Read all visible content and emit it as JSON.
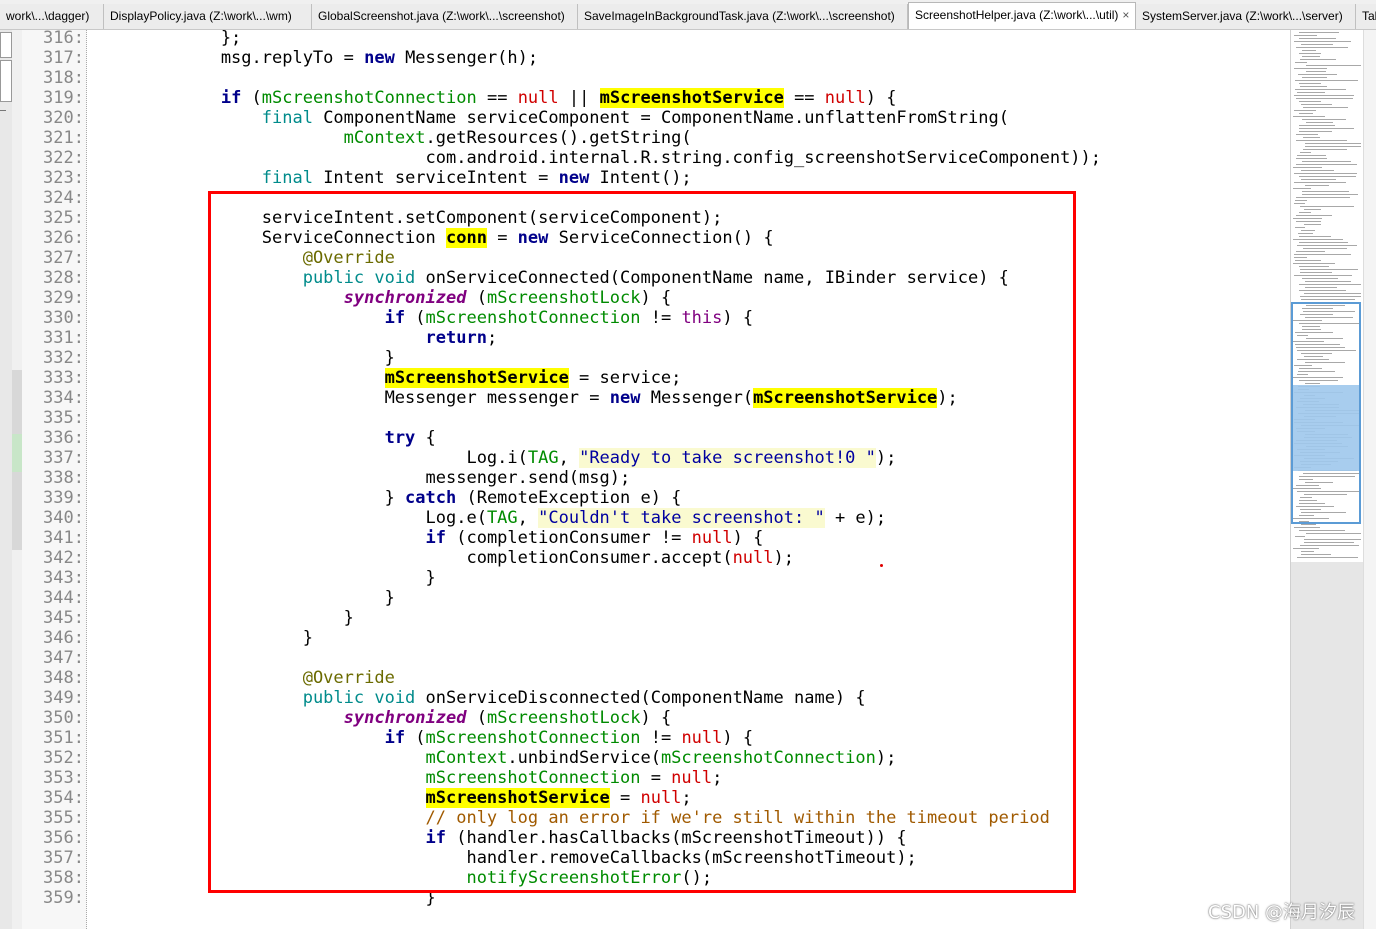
{
  "tabs": [
    {
      "label": "work\\...\\dagger)",
      "active": false
    },
    {
      "label": "DisplayPolicy.java (Z:\\work\\...\\wm)",
      "active": false
    },
    {
      "label": "GlobalScreenshot.java (Z:\\work\\...\\screenshot)",
      "active": false
    },
    {
      "label": "SaveImageInBackgroundTask.java (Z:\\work\\...\\screenshot)",
      "active": false
    },
    {
      "label": "ScreenshotHelper.java (Z:\\work\\...\\util)",
      "active": true
    },
    {
      "label": "SystemServer.java (Z:\\work\\...\\server)",
      "active": false
    },
    {
      "label": "Tak",
      "active": false
    }
  ],
  "close_glyph": "×",
  "watermark": "CSDN @海月汐辰",
  "lines": [
    {
      "n": "316:",
      "s": [
        [
          "p",
          "            };"
        ]
      ]
    },
    {
      "n": "317:",
      "s": [
        [
          "p",
          "            msg.replyTo = "
        ],
        [
          "kw",
          "new"
        ],
        [
          "p",
          " Messenger(h);"
        ]
      ]
    },
    {
      "n": "318:",
      "s": []
    },
    {
      "n": "319:",
      "s": [
        [
          "p",
          "            "
        ],
        [
          "kw",
          "if"
        ],
        [
          "p",
          " ("
        ],
        [
          "field",
          "mScreenshotConnection"
        ],
        [
          "p",
          " == "
        ],
        [
          "nul",
          "null"
        ],
        [
          "p",
          " || "
        ],
        [
          "hl",
          "mScreenshotService"
        ],
        [
          "p",
          " == "
        ],
        [
          "nul",
          "null"
        ],
        [
          "p",
          ") {"
        ]
      ]
    },
    {
      "n": "320:",
      "s": [
        [
          "p",
          "                "
        ],
        [
          "mod",
          "final"
        ],
        [
          "p",
          " ComponentName serviceComponent = ComponentName.unflattenFromString("
        ]
      ]
    },
    {
      "n": "321:",
      "s": [
        [
          "p",
          "                        "
        ],
        [
          "field",
          "mContext"
        ],
        [
          "p",
          ".getResources().getString("
        ]
      ]
    },
    {
      "n": "322:",
      "s": [
        [
          "p",
          "                                com.android.internal.R.string.config_screenshotServiceComponent));"
        ]
      ]
    },
    {
      "n": "323:",
      "s": [
        [
          "p",
          "                "
        ],
        [
          "mod",
          "final"
        ],
        [
          "p",
          " Intent serviceIntent = "
        ],
        [
          "kw",
          "new"
        ],
        [
          "p",
          " Intent();"
        ]
      ]
    },
    {
      "n": "324:",
      "s": []
    },
    {
      "n": "325:",
      "s": [
        [
          "p",
          "                serviceIntent.setComponent(serviceComponent);"
        ]
      ]
    },
    {
      "n": "326:",
      "s": [
        [
          "p",
          "                ServiceConnection "
        ],
        [
          "hl",
          "conn"
        ],
        [
          "p",
          " = "
        ],
        [
          "kw",
          "new"
        ],
        [
          "p",
          " ServiceConnection() {"
        ]
      ]
    },
    {
      "n": "327:",
      "s": [
        [
          "p",
          "                    "
        ],
        [
          "ann",
          "@Override"
        ]
      ]
    },
    {
      "n": "328:",
      "s": [
        [
          "p",
          "                    "
        ],
        [
          "mod",
          "public void"
        ],
        [
          "p",
          " onServiceConnected(ComponentName name, IBinder service) {"
        ]
      ]
    },
    {
      "n": "329:",
      "s": [
        [
          "p",
          "                        "
        ],
        [
          "syn",
          "synchronized"
        ],
        [
          "p",
          " ("
        ],
        [
          "field",
          "mScreenshotLock"
        ],
        [
          "p",
          ") {"
        ]
      ]
    },
    {
      "n": "330:",
      "s": [
        [
          "p",
          "                            "
        ],
        [
          "kw",
          "if"
        ],
        [
          "p",
          " ("
        ],
        [
          "field",
          "mScreenshotConnection"
        ],
        [
          "p",
          " != "
        ],
        [
          "pu",
          "this"
        ],
        [
          "p",
          ") {"
        ]
      ]
    },
    {
      "n": "331:",
      "s": [
        [
          "p",
          "                                "
        ],
        [
          "kw",
          "return"
        ],
        [
          "p",
          ";"
        ]
      ]
    },
    {
      "n": "332:",
      "s": [
        [
          "p",
          "                            }"
        ]
      ]
    },
    {
      "n": "333:",
      "s": [
        [
          "p",
          "                            "
        ],
        [
          "hl",
          "mScreenshotService"
        ],
        [
          "p",
          " = service;"
        ]
      ]
    },
    {
      "n": "334:",
      "s": [
        [
          "p",
          "                            Messenger messenger = "
        ],
        [
          "kw",
          "new"
        ],
        [
          "p",
          " Messenger("
        ],
        [
          "hl",
          "mScreenshotService"
        ],
        [
          "p",
          ");"
        ]
      ]
    },
    {
      "n": "335:",
      "s": []
    },
    {
      "n": "336:",
      "s": [
        [
          "p",
          "                            "
        ],
        [
          "kw",
          "try"
        ],
        [
          "p",
          " {"
        ]
      ]
    },
    {
      "n": "337:",
      "s": [
        [
          "p",
          "                                    Log.i("
        ],
        [
          "field",
          "TAG"
        ],
        [
          "p",
          ", "
        ],
        [
          "str",
          "\"Ready to take screenshot!0 \""
        ],
        [
          "p",
          ");"
        ]
      ]
    },
    {
      "n": "338:",
      "s": [
        [
          "p",
          "                                messenger.send(msg);"
        ]
      ]
    },
    {
      "n": "339:",
      "s": [
        [
          "p",
          "                            } "
        ],
        [
          "kw",
          "catch"
        ],
        [
          "p",
          " (RemoteException e) {"
        ]
      ]
    },
    {
      "n": "340:",
      "s": [
        [
          "p",
          "                                Log.e("
        ],
        [
          "field",
          "TAG"
        ],
        [
          "p",
          ", "
        ],
        [
          "str",
          "\"Couldn't take screenshot: \""
        ],
        [
          "p",
          " + e);"
        ]
      ]
    },
    {
      "n": "341:",
      "s": [
        [
          "p",
          "                                "
        ],
        [
          "kw",
          "if"
        ],
        [
          "p",
          " (completionConsumer != "
        ],
        [
          "nul",
          "null"
        ],
        [
          "p",
          ") {"
        ]
      ]
    },
    {
      "n": "342:",
      "s": [
        [
          "p",
          "                                    completionConsumer.accept("
        ],
        [
          "nul",
          "null"
        ],
        [
          "p",
          ");"
        ]
      ]
    },
    {
      "n": "343:",
      "s": [
        [
          "p",
          "                                }"
        ]
      ]
    },
    {
      "n": "344:",
      "s": [
        [
          "p",
          "                            }"
        ]
      ]
    },
    {
      "n": "345:",
      "s": [
        [
          "p",
          "                        }"
        ]
      ]
    },
    {
      "n": "346:",
      "s": [
        [
          "p",
          "                    }"
        ]
      ]
    },
    {
      "n": "347:",
      "s": []
    },
    {
      "n": "348:",
      "s": [
        [
          "p",
          "                    "
        ],
        [
          "ann",
          "@Override"
        ]
      ]
    },
    {
      "n": "349:",
      "s": [
        [
          "p",
          "                    "
        ],
        [
          "mod",
          "public void"
        ],
        [
          "p",
          " onServiceDisconnected(ComponentName name) {"
        ]
      ]
    },
    {
      "n": "350:",
      "s": [
        [
          "p",
          "                        "
        ],
        [
          "syn",
          "synchronized"
        ],
        [
          "p",
          " ("
        ],
        [
          "field",
          "mScreenshotLock"
        ],
        [
          "p",
          ") {"
        ]
      ]
    },
    {
      "n": "351:",
      "s": [
        [
          "p",
          "                            "
        ],
        [
          "kw",
          "if"
        ],
        [
          "p",
          " ("
        ],
        [
          "field",
          "mScreenshotConnection"
        ],
        [
          "p",
          " != "
        ],
        [
          "nul",
          "null"
        ],
        [
          "p",
          ") {"
        ]
      ]
    },
    {
      "n": "352:",
      "s": [
        [
          "p",
          "                                "
        ],
        [
          "field",
          "mContext"
        ],
        [
          "p",
          ".unbindService("
        ],
        [
          "field",
          "mScreenshotConnection"
        ],
        [
          "p",
          ");"
        ]
      ]
    },
    {
      "n": "353:",
      "s": [
        [
          "p",
          "                                "
        ],
        [
          "field",
          "mScreenshotConnection"
        ],
        [
          "p",
          " = "
        ],
        [
          "nul",
          "null"
        ],
        [
          "p",
          ";"
        ]
      ]
    },
    {
      "n": "354:",
      "s": [
        [
          "p",
          "                                "
        ],
        [
          "hl",
          "mScreenshotService"
        ],
        [
          "p",
          " = "
        ],
        [
          "nul",
          "null"
        ],
        [
          "p",
          ";"
        ]
      ]
    },
    {
      "n": "355:",
      "s": [
        [
          "p",
          "                                "
        ],
        [
          "cmt",
          "// only log an error if we're still within the timeout period"
        ]
      ]
    },
    {
      "n": "356:",
      "s": [
        [
          "p",
          "                                "
        ],
        [
          "kw",
          "if"
        ],
        [
          "p",
          " (handler.hasCallbacks(mScreenshotTimeout)) {"
        ]
      ]
    },
    {
      "n": "357:",
      "s": [
        [
          "p",
          "                                    handler.removeCallbacks(mScreenshotTimeout);"
        ]
      ]
    },
    {
      "n": "358:",
      "s": [
        [
          "p",
          "                                    "
        ],
        [
          "field",
          "notifyScreenshotError"
        ],
        [
          "p",
          "();"
        ]
      ]
    },
    {
      "n": "359:",
      "s": [
        [
          "p",
          "                                }"
        ]
      ]
    }
  ],
  "colors": {
    "highlight": "#ffff00",
    "annotation_box": "#ff0000",
    "minimap_view": "#9ec8ec"
  }
}
